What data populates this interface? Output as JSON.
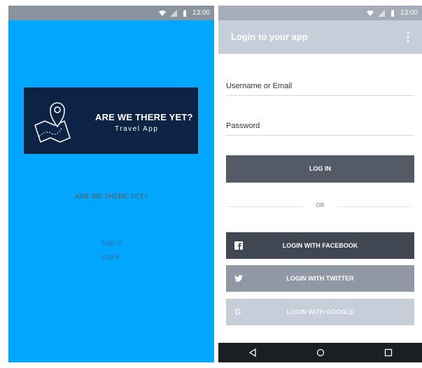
{
  "status": {
    "time": "13:00"
  },
  "splash": {
    "logo": {
      "title": "ARE WE THERE YET?",
      "subtitle": "Travel App"
    },
    "heading": "ARE WE THERE YET?",
    "links": [
      "Sign in",
      "Log in"
    ]
  },
  "login": {
    "toolbar": {
      "title": "Login to your app"
    },
    "fields": {
      "username_label": "Username or Email",
      "password_label": "Password"
    },
    "buttons": {
      "login": "LOG IN",
      "or": "OR",
      "facebook": "LOGIN WITH FACEBOOK",
      "twitter": "LOGIN WITH TWITTER",
      "google": "LOGIN WITH GOOGLE"
    }
  },
  "colors": {
    "splash_background": "#00a6ff",
    "logo_background": "#0d2345",
    "toolbar": "#c5ced9",
    "login_button": "#545b66",
    "facebook_button": "#3f4753",
    "twitter_button": "#8f98a4",
    "google_button": "#c5ced9"
  },
  "icons": [
    "wifi-icon",
    "signal-icon",
    "battery-icon",
    "map-pin-icon",
    "overflow-menu-icon",
    "facebook-icon",
    "twitter-icon",
    "google-icon",
    "back-icon",
    "home-icon",
    "recents-icon"
  ]
}
